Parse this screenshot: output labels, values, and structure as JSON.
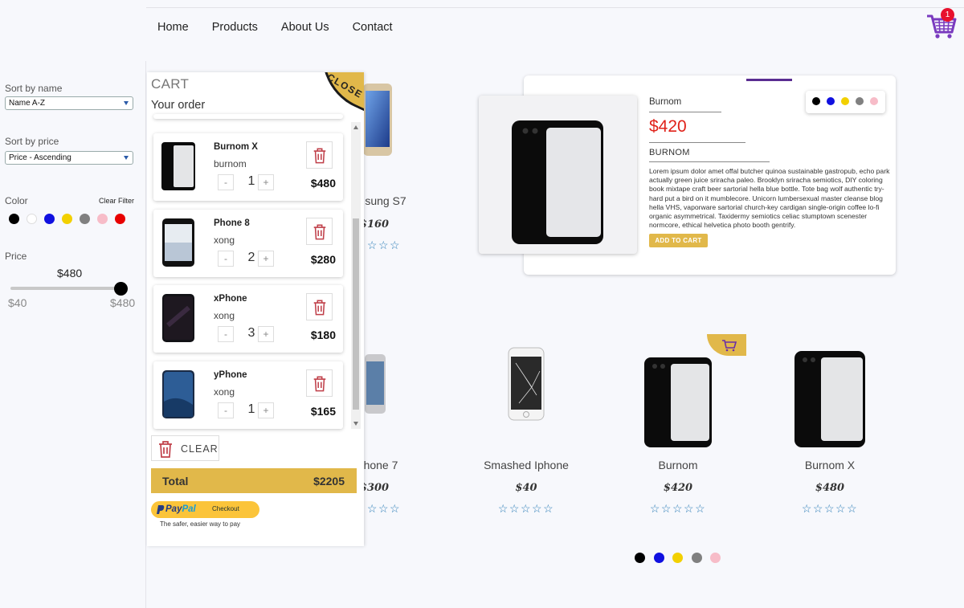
{
  "nav": {
    "items": [
      "Home",
      "Products",
      "About Us",
      "Contact"
    ],
    "cart_count": "1"
  },
  "filters": {
    "sort_name_label": "Sort by name",
    "sort_name_value": "Name A-Z",
    "sort_price_label": "Sort by price",
    "sort_price_value": "Price - Ascending",
    "color_label": "Color",
    "clear_filter": "Clear Filter",
    "colors": [
      "#000000",
      "#ffffff",
      "#1010e0",
      "#f2d000",
      "#808080",
      "#f7bcc8",
      "#e80000"
    ],
    "price_label": "Price",
    "price_value": "$480",
    "price_min": "$40",
    "price_max": "$480",
    "price_fraction": 1.0
  },
  "products": {
    "row1": [
      {
        "name": "sung S7",
        "price": "$160",
        "stars": "☆☆☆"
      }
    ],
    "row2": [
      {
        "name": "hone 7",
        "price": "$300",
        "stars": "☆☆☆"
      },
      {
        "name": "Smashed Iphone",
        "price": "$40",
        "stars": "☆☆☆☆☆"
      },
      {
        "name": "Burnom",
        "price": "$420",
        "stars": "☆☆☆☆☆"
      },
      {
        "name": "Burnom X",
        "price": "$480",
        "stars": "☆☆☆☆☆"
      }
    ]
  },
  "detail": {
    "brand": "Burnom",
    "price": "$420",
    "name": "BURNOM",
    "description": "Lorem ipsum dolor amet offal butcher quinoa sustainable gastropub, echo park actually green juice sriracha paleo. Brooklyn sriracha semiotics, DIY coloring book mixtape craft beer sartorial hella blue bottle. Tote bag wolf authentic try-hard put a bird on it mumblecore. Unicorn lumbersexual master cleanse blog hella VHS, vaporware sartorial church-key cardigan single-origin coffee lo-fi organic asymmetrical. Taxidermy semiotics celiac stumptown scenester normcore, ethical helvetica photo booth gentrify.",
    "add_to_cart": "ADD TO CART",
    "swatches": [
      "#000000",
      "#1010e0",
      "#f2d000",
      "#808080",
      "#f7bcc8"
    ]
  },
  "pager_dots": [
    "#000000",
    "#1010e0",
    "#f2d000",
    "#808080",
    "#f7bcc8"
  ],
  "cart": {
    "title": "CART",
    "subtitle": "Your order",
    "close": "CLOSE",
    "items": [
      {
        "name": "Burnom X",
        "brand": "burnom",
        "qty": "1",
        "price": "$480",
        "minus": "-",
        "plus": "+"
      },
      {
        "name": "Phone 8",
        "brand": "xong",
        "qty": "2",
        "price": "$280",
        "minus": "-",
        "plus": "+"
      },
      {
        "name": "xPhone",
        "brand": "xong",
        "qty": "3",
        "price": "$180",
        "minus": "-",
        "plus": "+"
      },
      {
        "name": "yPhone",
        "brand": "xong",
        "qty": "1",
        "price": "$165",
        "minus": "-",
        "plus": "+"
      }
    ],
    "clear": "CLEAR",
    "total_label": "Total",
    "total_value": "$2205",
    "paypal_pay": "Pay",
    "paypal_pal": "Pal",
    "paypal_checkout": "Checkout",
    "paypal_tagline": "The safer, easier way to pay"
  }
}
